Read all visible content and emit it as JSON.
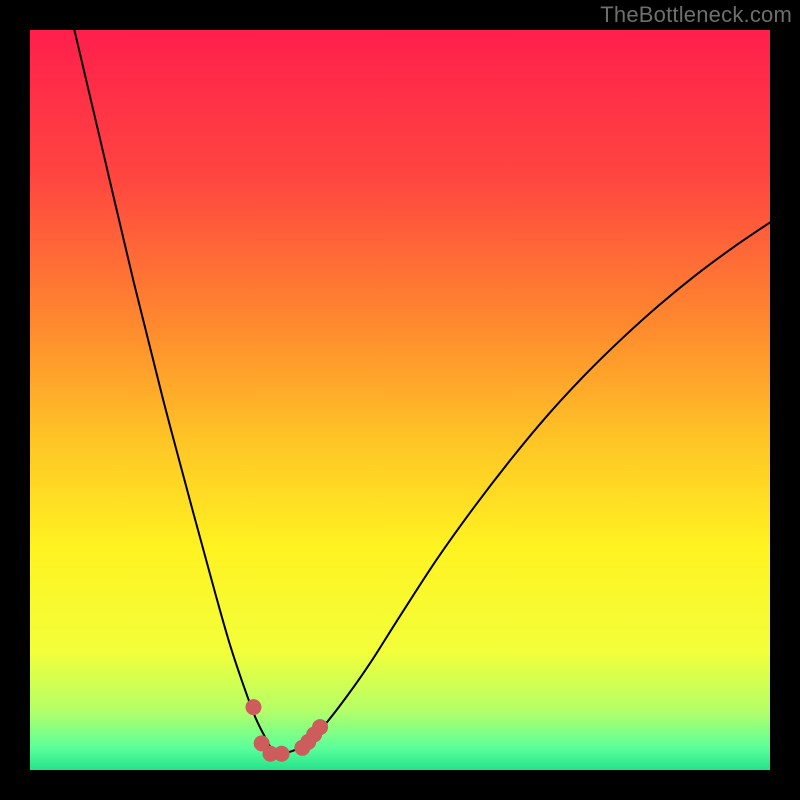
{
  "watermark": "TheBottleneck.com",
  "chart_data": {
    "type": "line",
    "title": "",
    "xlabel": "",
    "ylabel": "",
    "xlim": [
      0,
      100
    ],
    "ylim": [
      0,
      100
    ],
    "grid": false,
    "legend": false,
    "background_gradient": {
      "type": "vertical",
      "stops": [
        {
          "pos": 0.0,
          "color": "#ff1f4c"
        },
        {
          "pos": 0.2,
          "color": "#ff4640"
        },
        {
          "pos": 0.4,
          "color": "#ff8a2e"
        },
        {
          "pos": 0.55,
          "color": "#ffc326"
        },
        {
          "pos": 0.7,
          "color": "#fff321"
        },
        {
          "pos": 0.84,
          "color": "#f2ff3a"
        },
        {
          "pos": 0.92,
          "color": "#b4ff68"
        },
        {
          "pos": 0.97,
          "color": "#5cff9a"
        },
        {
          "pos": 1.0,
          "color": "#24e28b"
        }
      ]
    },
    "series": [
      {
        "name": "bottleneck-curve",
        "color": "#000000",
        "stroke_width": 2,
        "x": [
          6,
          10,
          14,
          18,
          22,
          25,
          27,
          29,
          30.5,
          32,
          33.2,
          34.2,
          36,
          38,
          40,
          43,
          46,
          50,
          55,
          60,
          65,
          70,
          75,
          80,
          85,
          90,
          95,
          100
        ],
        "y": [
          100,
          83,
          66,
          50,
          35,
          24,
          17,
          11,
          7,
          4,
          2,
          2.2,
          2.8,
          4.2,
          6.3,
          10.2,
          14.5,
          20.8,
          28.5,
          35.5,
          42.0,
          48.0,
          53.4,
          58.3,
          62.8,
          66.9,
          70.6,
          74.0
        ]
      }
    ],
    "markers": {
      "name": "highlight-dots",
      "color": "#cd5c5c",
      "radius": 8,
      "points": [
        {
          "x": 30.2,
          "y": 8.5
        },
        {
          "x": 31.3,
          "y": 3.6
        },
        {
          "x": 32.5,
          "y": 2.2
        },
        {
          "x": 34.0,
          "y": 2.2
        },
        {
          "x": 36.8,
          "y": 3.0
        },
        {
          "x": 37.6,
          "y": 3.8
        },
        {
          "x": 38.4,
          "y": 4.8
        },
        {
          "x": 39.2,
          "y": 5.8
        }
      ]
    }
  }
}
